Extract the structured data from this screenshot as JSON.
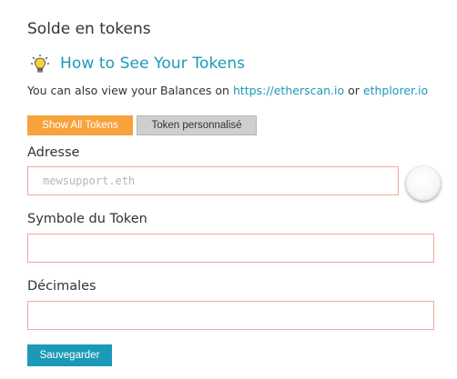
{
  "panel": {
    "title": "Solde en tokens"
  },
  "help": {
    "icon": "lightbulb-icon",
    "link_label": "How to See Your Tokens",
    "description_prefix": "You can also view your Balances on ",
    "etherscan_label": "https://etherscan.io",
    "description_middle": " or ",
    "ethplorer_label": "ethplorer.io"
  },
  "tabs": {
    "show_all_label": "Show All Tokens",
    "custom_label": "Token personnalisé"
  },
  "form": {
    "address_label": "Adresse",
    "address_placeholder": "mewsupport.eth",
    "address_value": "",
    "symbol_label": "Symbole du Token",
    "symbol_value": "",
    "decimals_label": "Décimales",
    "decimals_value": "",
    "save_label": "Sauvegarder"
  },
  "colors": {
    "accent_blue": "#1a9ab8",
    "orange": "#f7a23b",
    "input_border": "#f0a9a0",
    "gray_button": "#cfcfcf"
  }
}
